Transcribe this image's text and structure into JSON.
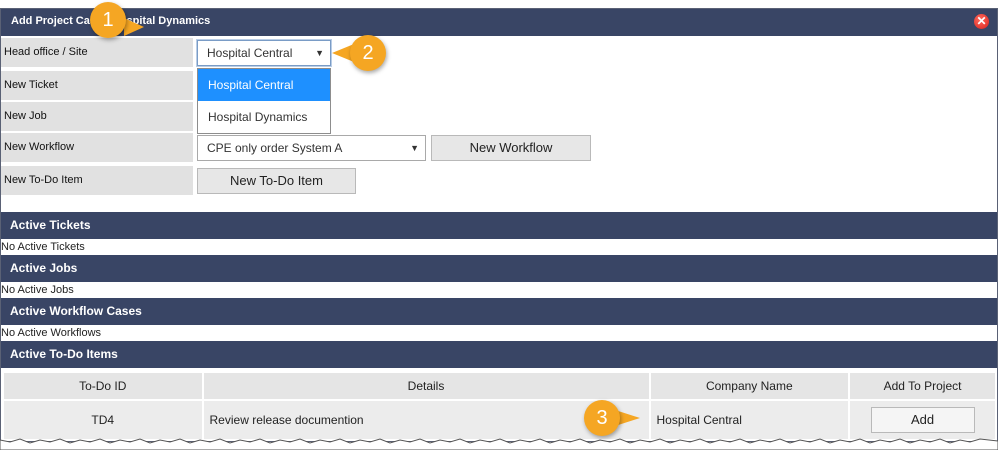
{
  "dialog": {
    "title": "Add Project Case - Hospital Dynamics",
    "close_icon": "close-icon",
    "close_color": "#e5261d"
  },
  "form": {
    "head_office": {
      "label": "Head office / Site",
      "value": "Hospital Central",
      "options": [
        "Hospital Central",
        "Hospital Dynamics"
      ],
      "selected_index": 0
    },
    "new_ticket": {
      "label": "New Ticket"
    },
    "new_job": {
      "label": "New Job"
    },
    "new_workflow": {
      "label": "New Workflow",
      "select_value": "CPE only order System A",
      "button_label": "New Workflow"
    },
    "new_todo": {
      "label": "New To-Do Item",
      "button_label": "New To-Do Item"
    }
  },
  "sections": {
    "tickets": {
      "title": "Active Tickets",
      "empty": "No Active Tickets"
    },
    "jobs": {
      "title": "Active Jobs",
      "empty": "No Active Jobs"
    },
    "workflows": {
      "title": "Active Workflow Cases",
      "empty": "No Active Workflows"
    },
    "todos": {
      "title": "Active To-Do Items"
    }
  },
  "todo_table": {
    "headers": [
      "To-Do ID",
      "Details",
      "Company Name",
      "Add To Project"
    ],
    "rows": [
      {
        "id": "TD4",
        "details": "Review release documention",
        "company": "Hospital Central",
        "action": "Add"
      }
    ]
  },
  "callouts": [
    "1",
    "2",
    "3"
  ],
  "colors": {
    "header_bg": "#394565",
    "label_bg": "#e1e1e1",
    "selected_option": "#1e90ff",
    "callout": "#f5a623"
  }
}
